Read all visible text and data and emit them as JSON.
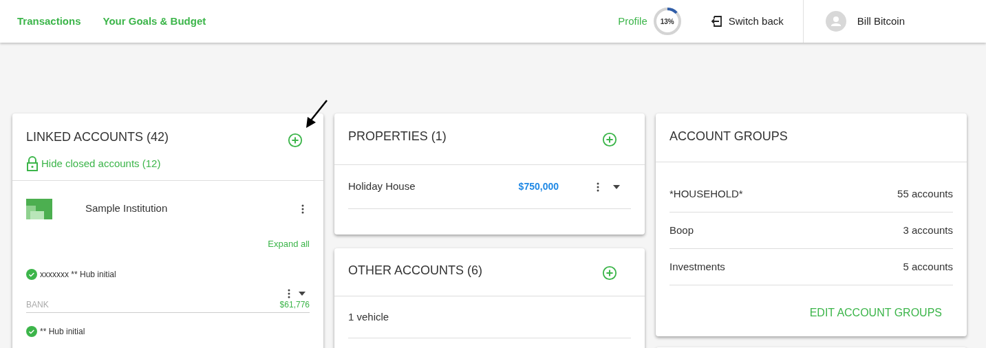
{
  "nav": {
    "links": [
      {
        "label": "Transactions"
      },
      {
        "label": "Your Goals & Budget"
      }
    ],
    "profile": {
      "label": "Profile",
      "reading": "13%",
      "level": 0.13
    },
    "switch_back": {
      "label": "Switch back"
    },
    "user": {
      "name": "Bill Bitcoin"
    }
  },
  "linked_accounts": {
    "title": "LINKED ACCOUNTS (42)",
    "hide_closed": "Hide closed accounts (12)",
    "institution": {
      "name": "Sample Institution",
      "expand_all": "Expand all",
      "accounts": [
        {
          "name": "xxxxxxx ** Hub initial",
          "verified": true,
          "type": "BANK",
          "balance": "$61,776"
        },
        {
          "name": "** Hub initial",
          "verified": true
        }
      ]
    }
  },
  "properties": {
    "title": "PROPERTIES (1)",
    "items": [
      {
        "name": "Holiday House",
        "value": "$750,000"
      }
    ]
  },
  "other_accounts": {
    "title": "OTHER ACCOUNTS (6)",
    "items": [
      {
        "name": "1 vehicle"
      }
    ]
  },
  "account_groups": {
    "title": "ACCOUNT GROUPS",
    "groups": [
      {
        "name": "*HOUSEHOLD*",
        "count": "55 accounts"
      },
      {
        "name": "Boop",
        "count": "3 accounts"
      },
      {
        "name": "Investments",
        "count": "5 accounts"
      }
    ],
    "action": "EDIT ACCOUNT GROUPS"
  }
}
